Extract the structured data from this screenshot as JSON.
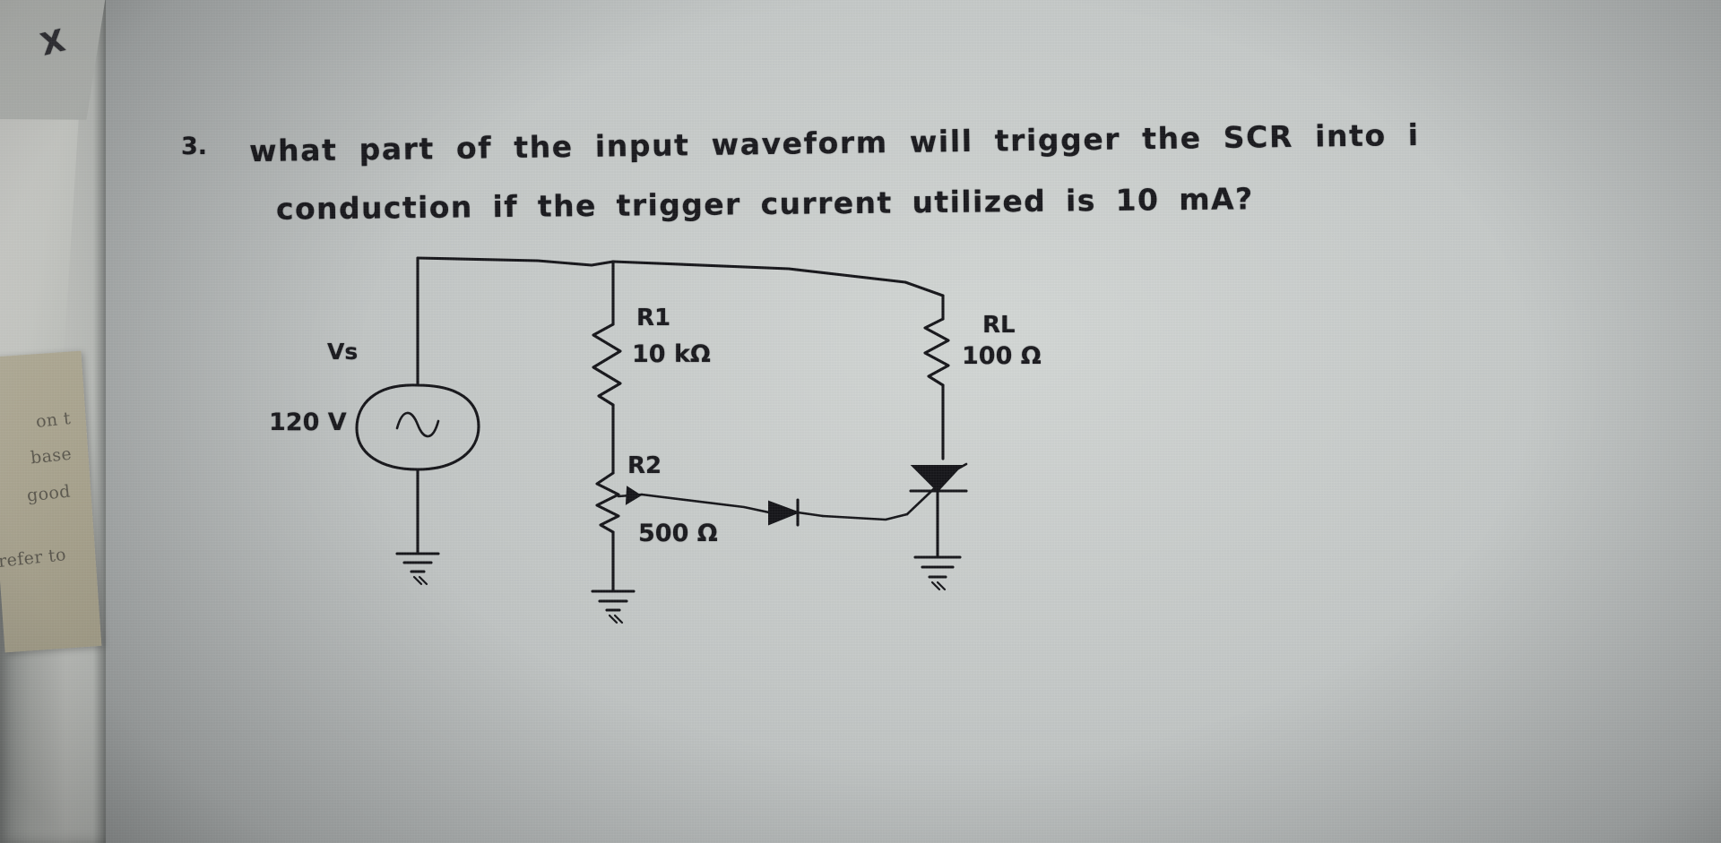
{
  "document": {
    "kind": "handwritten-worksheet-photo",
    "ink_color": "#17171b",
    "paper_color": "#c9ccc8"
  },
  "question": {
    "number": "3.",
    "line1": "what part of the input waveform will trigger the SCR into i",
    "line2": "conduction if the trigger current utilized is 10 mA?"
  },
  "margin_notes": {
    "corner_mark": "X",
    "note1": "on t",
    "note2": "base",
    "note3": "good",
    "note4": "refer to"
  },
  "circuit": {
    "source": {
      "label": "Vs",
      "value": "120 V",
      "symbol": "ac-sine"
    },
    "components": [
      {
        "ref": "R1",
        "label": "R1",
        "value": "10 kΩ",
        "value_text": "10 kΩ"
      },
      {
        "ref": "R2",
        "label": "R2",
        "value": "500 Ω",
        "value_text": "500 Ω"
      },
      {
        "ref": "RL",
        "label": "RL",
        "value": "100 Ω",
        "value_text": "100 Ω"
      }
    ],
    "devices": [
      {
        "name": "SCR",
        "symbol": "thyristor"
      },
      {
        "name": "diode",
        "symbol": "diode"
      }
    ],
    "grounds": 3,
    "notes": "R1 and R2 form a voltage divider across the AC source; the divider tap feeds a diode into the SCR gate; RL is in series with the SCR anode."
  }
}
